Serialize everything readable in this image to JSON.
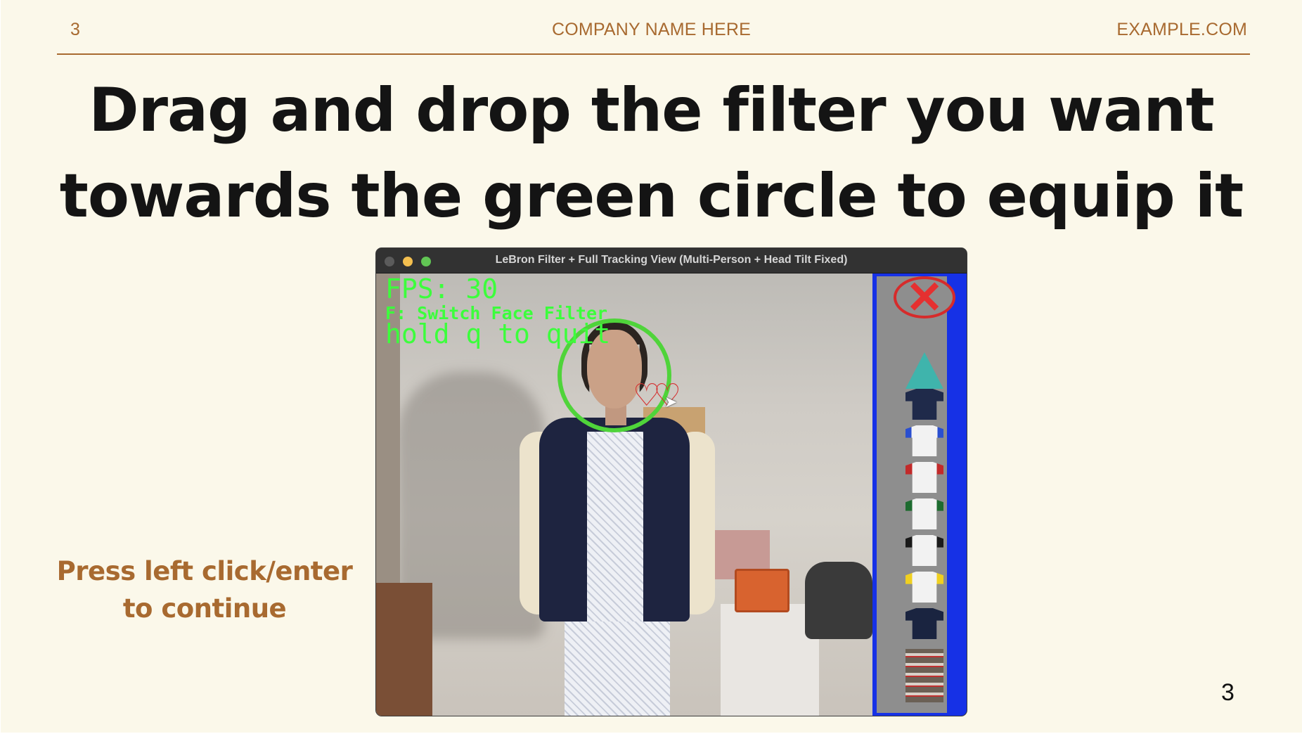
{
  "header": {
    "slide_number": "3",
    "company": "COMPANY NAME HERE",
    "website": "EXAMPLE.COM"
  },
  "title": {
    "line1": "Drag and drop the filter you want",
    "line2": "towards the green circle to equip it"
  },
  "instruction": {
    "line1": "Press left click/enter",
    "line2": "to continue"
  },
  "page_number": "3",
  "window": {
    "title": "LeBron Filter + Full Tracking View (Multi-Person + Head Tilt Fixed)",
    "hud": {
      "fps": "FPS: 30",
      "switch_filter": "F: Switch Face Filter",
      "quit": "hold q to quit"
    },
    "filter_panel": {
      "items": [
        {
          "name": "remove-filter",
          "icon": "red-x-icon"
        },
        {
          "name": "party-hat",
          "color": "#3fb4ac"
        },
        {
          "name": "navy-polo",
          "color": "#1f2a4a"
        },
        {
          "name": "white-blue-jersey",
          "color": "#f2f2f2",
          "accent": "#2a4fd0"
        },
        {
          "name": "white-red-jersey",
          "color": "#f2f2f2",
          "accent": "#c22a2a"
        },
        {
          "name": "white-green-jersey",
          "color": "#f2f2f2",
          "accent": "#1d6b2f"
        },
        {
          "name": "white-black-jersey",
          "color": "#f2f2f2",
          "accent": "#1a1a1a"
        },
        {
          "name": "white-yellow-jersey",
          "color": "#f2f2f2",
          "accent": "#f0d020"
        },
        {
          "name": "varsity-jacket",
          "color": "#1a2440"
        },
        {
          "name": "armor-suit",
          "color": "#6b6055",
          "accent": "#c03030"
        }
      ],
      "border_color": "#1631e6"
    },
    "ring_color": "#4fd43a",
    "hud_color": "#3cff3c"
  },
  "colors": {
    "background": "#fbf8ea",
    "accent": "#a86a30",
    "title": "#141414"
  }
}
